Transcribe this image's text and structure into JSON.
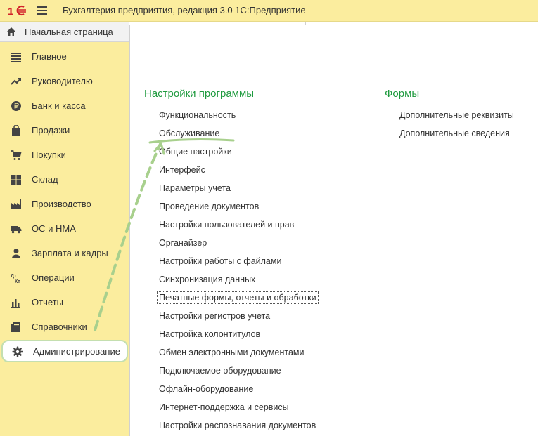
{
  "titlebar": {
    "app_title": "Бухгалтерия предприятия, редакция 3.0 1С:Предприятие"
  },
  "home": {
    "label": "Начальная страница",
    "icon": "home-icon"
  },
  "sidebar": {
    "items": [
      {
        "label": "Главное",
        "icon": "list-icon"
      },
      {
        "label": "Руководителю",
        "icon": "trend-icon"
      },
      {
        "label": "Банк и касса",
        "icon": "ruble-icon"
      },
      {
        "label": "Продажи",
        "icon": "bag-icon"
      },
      {
        "label": "Покупки",
        "icon": "cart-icon"
      },
      {
        "label": "Склад",
        "icon": "warehouse-icon"
      },
      {
        "label": "Производство",
        "icon": "factory-icon"
      },
      {
        "label": "ОС и НМА",
        "icon": "truck-icon"
      },
      {
        "label": "Зарплата и кадры",
        "icon": "person-icon"
      },
      {
        "label": "Операции",
        "icon": "dt-kt-icon"
      },
      {
        "label": "Отчеты",
        "icon": "bar-chart-icon"
      },
      {
        "label": "Справочники",
        "icon": "book-icon"
      },
      {
        "label": "Администрирование",
        "icon": "gear-icon"
      }
    ],
    "active_index": 12
  },
  "main": {
    "settings": {
      "title": "Настройки программы",
      "links": [
        "Функциональность",
        "Обслуживание",
        "Общие настройки",
        "Интерфейс",
        "Параметры учета",
        "Проведение документов",
        "Настройки пользователей и прав",
        "Органайзер",
        "Настройки работы с файлами",
        "Синхронизация данных",
        "Печатные формы, отчеты и обработки",
        "Настройки регистров учета",
        "Настройка колонтитулов",
        "Обмен электронными документами",
        "Подключаемое оборудование",
        "Офлайн-оборудование",
        "Интернет-поддержка и сервисы",
        "Настройки распознавания документов"
      ],
      "focused_index": 10,
      "underlined_index": 1
    },
    "forms": {
      "title": "Формы",
      "links": [
        "Дополнительные реквизиты",
        "Дополнительные сведения"
      ]
    }
  },
  "colors": {
    "sidebar_bg": "#fbed9e",
    "section_heading": "#1e9a3e",
    "highlight_green": "#a8d08d",
    "logo_red": "#d2232a"
  }
}
